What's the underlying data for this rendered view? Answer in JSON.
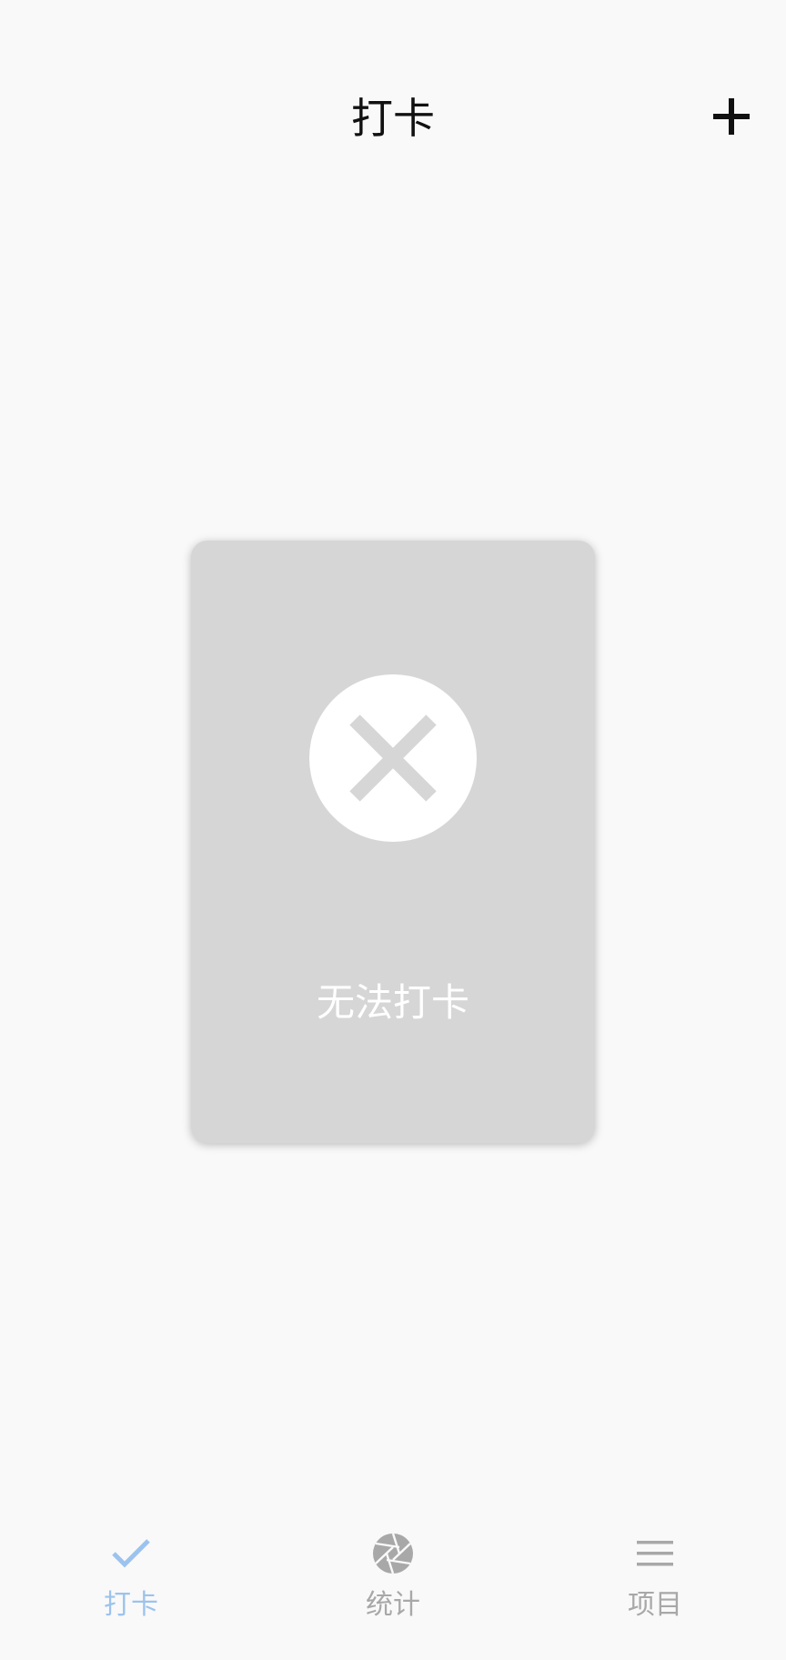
{
  "header": {
    "title": "打卡",
    "add_icon": "plus-icon"
  },
  "card": {
    "status_icon": "close-circle-icon",
    "label": "无法打卡"
  },
  "tabbar": {
    "items": [
      {
        "label": "打卡",
        "icon": "check-icon",
        "active": true
      },
      {
        "label": "统计",
        "icon": "aperture-icon",
        "active": false
      },
      {
        "label": "项目",
        "icon": "menu-icon",
        "active": false
      }
    ]
  },
  "colors": {
    "background": "#f9f9f9",
    "card": "#d6d6d6",
    "tab_active": "#9cc3ee",
    "tab_inactive": "#a8a8a8"
  }
}
